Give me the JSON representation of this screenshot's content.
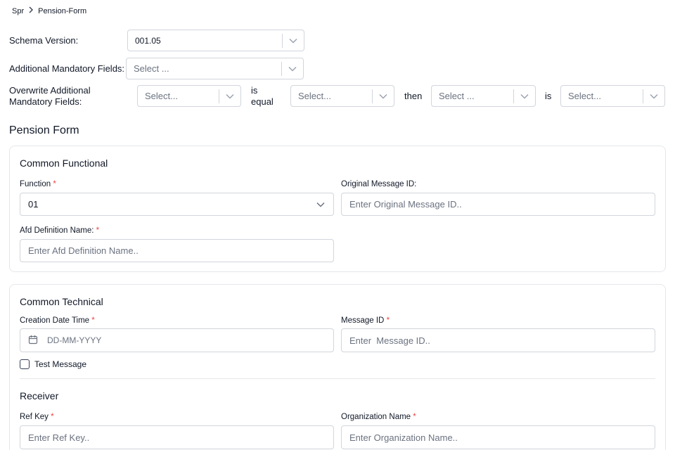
{
  "breadcrumb": {
    "root": "Spr",
    "current": "Pension-Form"
  },
  "schema": {
    "label": "Schema Version:",
    "value": "001.05"
  },
  "additional": {
    "label": "Additional Mandatory Fields:",
    "placeholder": "Select ..."
  },
  "overwrite": {
    "label_line1": "Overwrite Additional",
    "label_line2": "Mandatory Fields:",
    "select1": "Select...",
    "is_equal_line1": "is",
    "is_equal_line2": "equal",
    "select2": "Select...",
    "then": "then",
    "select3": "Select ...",
    "is": "is",
    "select4": "Select..."
  },
  "form_title": "Pension Form",
  "common_functional": {
    "title": "Common Functional",
    "function_label": "Function",
    "function_value": "01",
    "original_message_label": "Original Message ID:",
    "original_message_placeholder": "Enter Original Message ID..",
    "afd_label": "Afd Definition Name:",
    "afd_placeholder": "Enter Afd Definition Name.."
  },
  "common_technical": {
    "title": "Common Technical",
    "creation_label": "Creation Date Time",
    "creation_placeholder": "DD-MM-YYYY",
    "message_id_label": "Message ID",
    "message_id_placeholder": "Enter  Message ID..",
    "test_message_label": "Test Message"
  },
  "receiver": {
    "title": "Receiver",
    "ref_key_label": "Ref Key",
    "ref_key_placeholder": "Enter Ref Key..",
    "org_name_label": "Organization Name",
    "org_name_placeholder": "Enter Organization Name.."
  },
  "required_marker": "*"
}
